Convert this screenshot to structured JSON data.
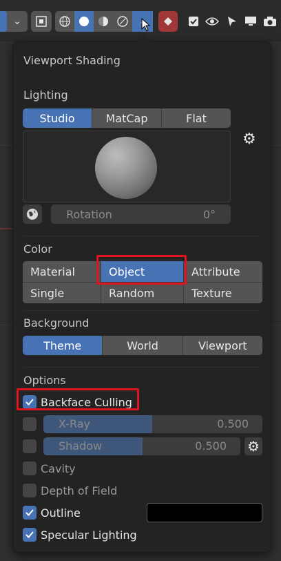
{
  "toolbar": {
    "chevron": "⌄"
  },
  "popover": {
    "title": "Viewport Shading",
    "lighting": {
      "label": "Lighting",
      "options": [
        "Studio",
        "MatCap",
        "Flat"
      ],
      "active": "Studio",
      "rotation_label": "Rotation",
      "rotation_value": "0°"
    },
    "color": {
      "label": "Color",
      "options": [
        "Material",
        "Object",
        "Attribute",
        "Single",
        "Random",
        "Texture"
      ],
      "active": "Object"
    },
    "background": {
      "label": "Background",
      "options": [
        "Theme",
        "World",
        "Viewport"
      ],
      "active": "Theme"
    },
    "options": {
      "label": "Options",
      "backface_culling": "Backface Culling",
      "xray_label": "X-Ray",
      "xray_value": "0.500",
      "shadow_label": "Shadow",
      "shadow_value": "0.500",
      "cavity": "Cavity",
      "dof": "Depth of Field",
      "outline": "Outline",
      "specular": "Specular Lighting"
    }
  },
  "colors": {
    "accent": "#4772b3",
    "highlight": "#e0141e",
    "outline_color": "#000000"
  }
}
